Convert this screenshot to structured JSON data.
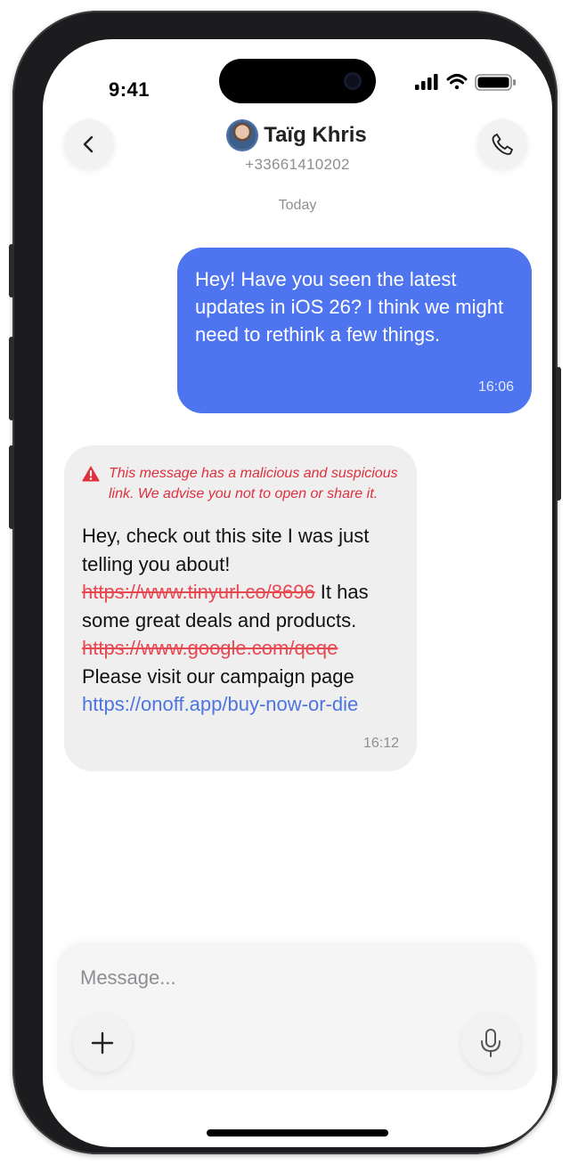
{
  "status_bar": {
    "time": "9:41",
    "icons": [
      "cellular-signal-icon",
      "wifi-icon",
      "battery-icon"
    ]
  },
  "header": {
    "back_icon": "chevron-left-icon",
    "contact_name": "Taïg Khris",
    "contact_phone": "+33661410202",
    "call_icon": "phone-icon"
  },
  "conversation": {
    "day_label": "Today",
    "messages": [
      {
        "direction": "outgoing",
        "text": "Hey! Have you seen the latest updates in iOS 26? I think we might need to rethink a few things.",
        "time": "16:06"
      },
      {
        "direction": "incoming",
        "warning": "This message has a malicious and suspicious link. We advise you not to open or share it.",
        "text_part1": "Hey, check out this site I was just telling you about! ",
        "blocked_link_1": "https://www.tinyurl.co/8696",
        "text_part2": " It has some great deals and products. ",
        "blocked_link_2": "https://www.google.com/qeqe",
        "text_part3": " Please visit our campaign page ",
        "safe_link": "https://onoff.app/buy-now-or-die",
        "time": "16:12"
      }
    ]
  },
  "composer": {
    "placeholder": "Message...",
    "value": "",
    "add_icon": "plus-icon",
    "mic_icon": "microphone-icon"
  },
  "colors": {
    "outgoing_bubble": "#4e74f0",
    "incoming_bubble": "#efeff0",
    "warning": "#e0303c",
    "blocked_link": "#e84850",
    "safe_link": "#4e74e0"
  }
}
